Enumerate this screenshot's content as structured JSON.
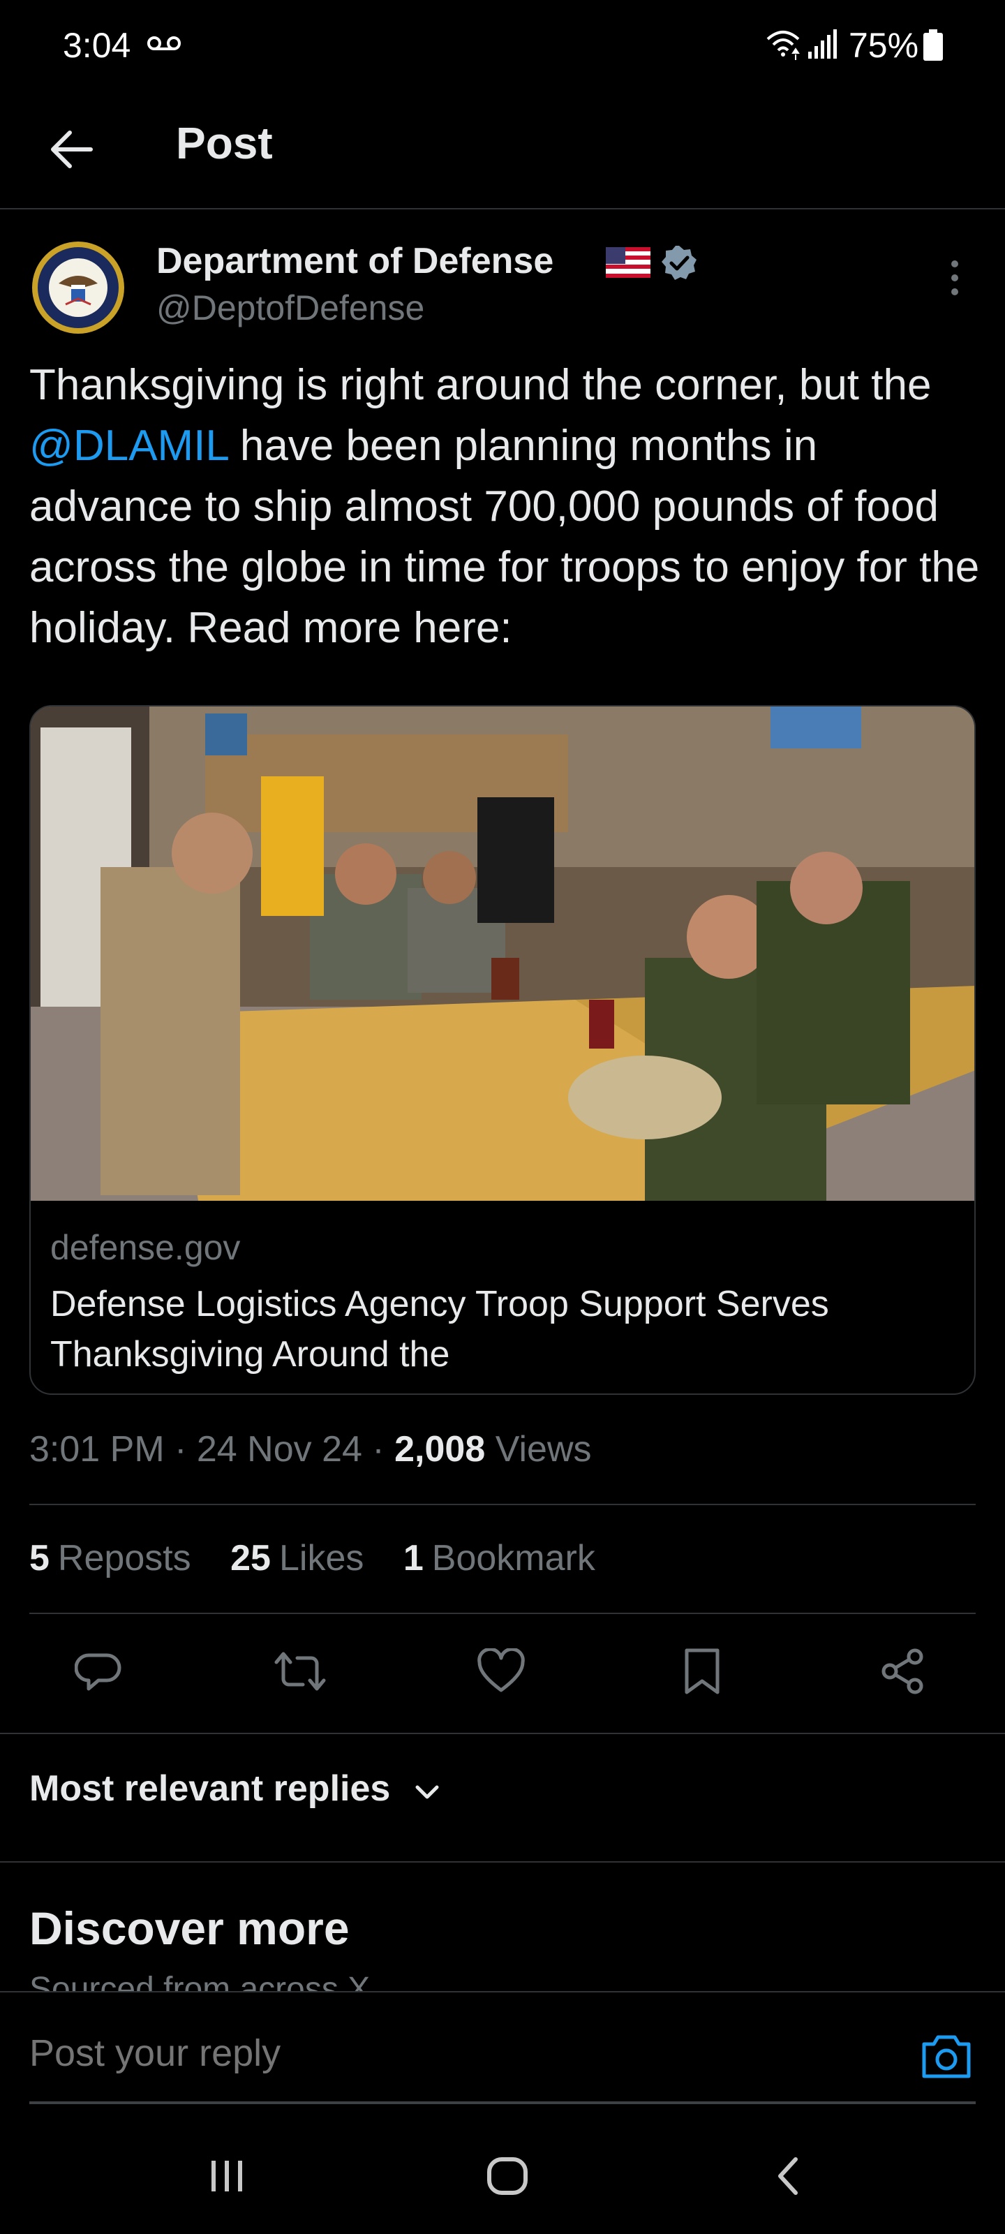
{
  "status_bar": {
    "time": "3:04",
    "battery": "75%"
  },
  "header": {
    "title": "Post"
  },
  "post": {
    "author_name": "Department of Defense",
    "author_handle": "@DeptofDefense",
    "text_before": "Thanksgiving is right around the corner, but the ",
    "mention": "@DLAMIL",
    "text_after": " have been planning months in advance to ship almost 700,000 pounds of food across the globe in time for troops to enjoy for the holiday. Read more here:",
    "card": {
      "domain": "defense.gov",
      "title": "Defense Logistics Agency Troop Support Serves Thanksgiving Around the"
    },
    "time": "3:01 PM",
    "date": "24 Nov 24",
    "views_count": "2,008",
    "views_label": "Views",
    "reposts_count": "5",
    "reposts_label": "Reposts",
    "likes_count": "25",
    "likes_label": "Likes",
    "bookmarks_count": "1",
    "bookmarks_label": "Bookmark"
  },
  "replies": {
    "sort_label": "Most relevant replies"
  },
  "discover": {
    "title": "Discover more",
    "subtitle": "Sourced from across X"
  },
  "reply_bar": {
    "placeholder": "Post your reply"
  },
  "colors": {
    "background": "#000000",
    "accent": "#1d9bf0",
    "secondary_text": "#71767b",
    "divider": "#2f3336"
  }
}
